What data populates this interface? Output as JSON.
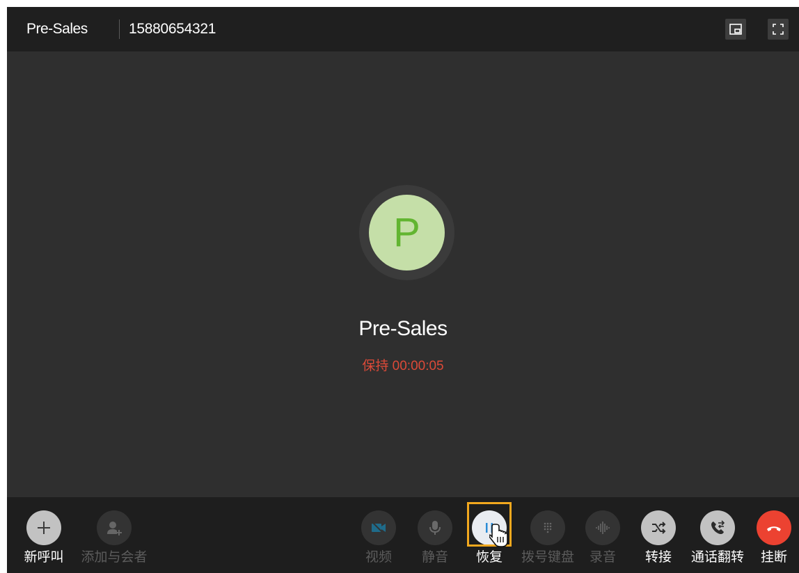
{
  "header": {
    "title": "Pre-Sales",
    "number": "15880654321",
    "buttons": [
      {
        "icon": "picture-in-picture-icon"
      },
      {
        "icon": "fullscreen-icon"
      }
    ]
  },
  "contact": {
    "avatar_initial": "P",
    "name": "Pre-Sales",
    "status": "保持 00:00:05",
    "avatar_color": "#c5dfa8",
    "avatar_text_color": "#62b531",
    "status_color": "#dc4a38"
  },
  "controls": {
    "new_call": {
      "label": "新呼叫",
      "icon": "plus-icon",
      "enabled": true
    },
    "add_participant": {
      "label": "添加与会者",
      "icon": "add-user-icon",
      "enabled": false
    },
    "video": {
      "label": "视频",
      "icon": "video-off-icon",
      "enabled": false
    },
    "mute": {
      "label": "静音",
      "icon": "microphone-icon",
      "enabled": false
    },
    "resume": {
      "label": "恢复",
      "icon": "pause-icon",
      "enabled": true,
      "highlighted": true
    },
    "dialpad": {
      "label": "拨号键盘",
      "icon": "dialpad-icon",
      "enabled": false
    },
    "record": {
      "label": "录音",
      "icon": "waveform-icon",
      "enabled": false
    },
    "transfer": {
      "label": "转接",
      "icon": "shuffle-icon",
      "enabled": true
    },
    "call_flip": {
      "label": "通话翻转",
      "icon": "call-flip-icon",
      "enabled": true
    },
    "hangup": {
      "label": "挂断",
      "icon": "hangup-icon",
      "enabled": true,
      "color": "#ec4231"
    }
  },
  "highlight_color": "#f2a81e"
}
